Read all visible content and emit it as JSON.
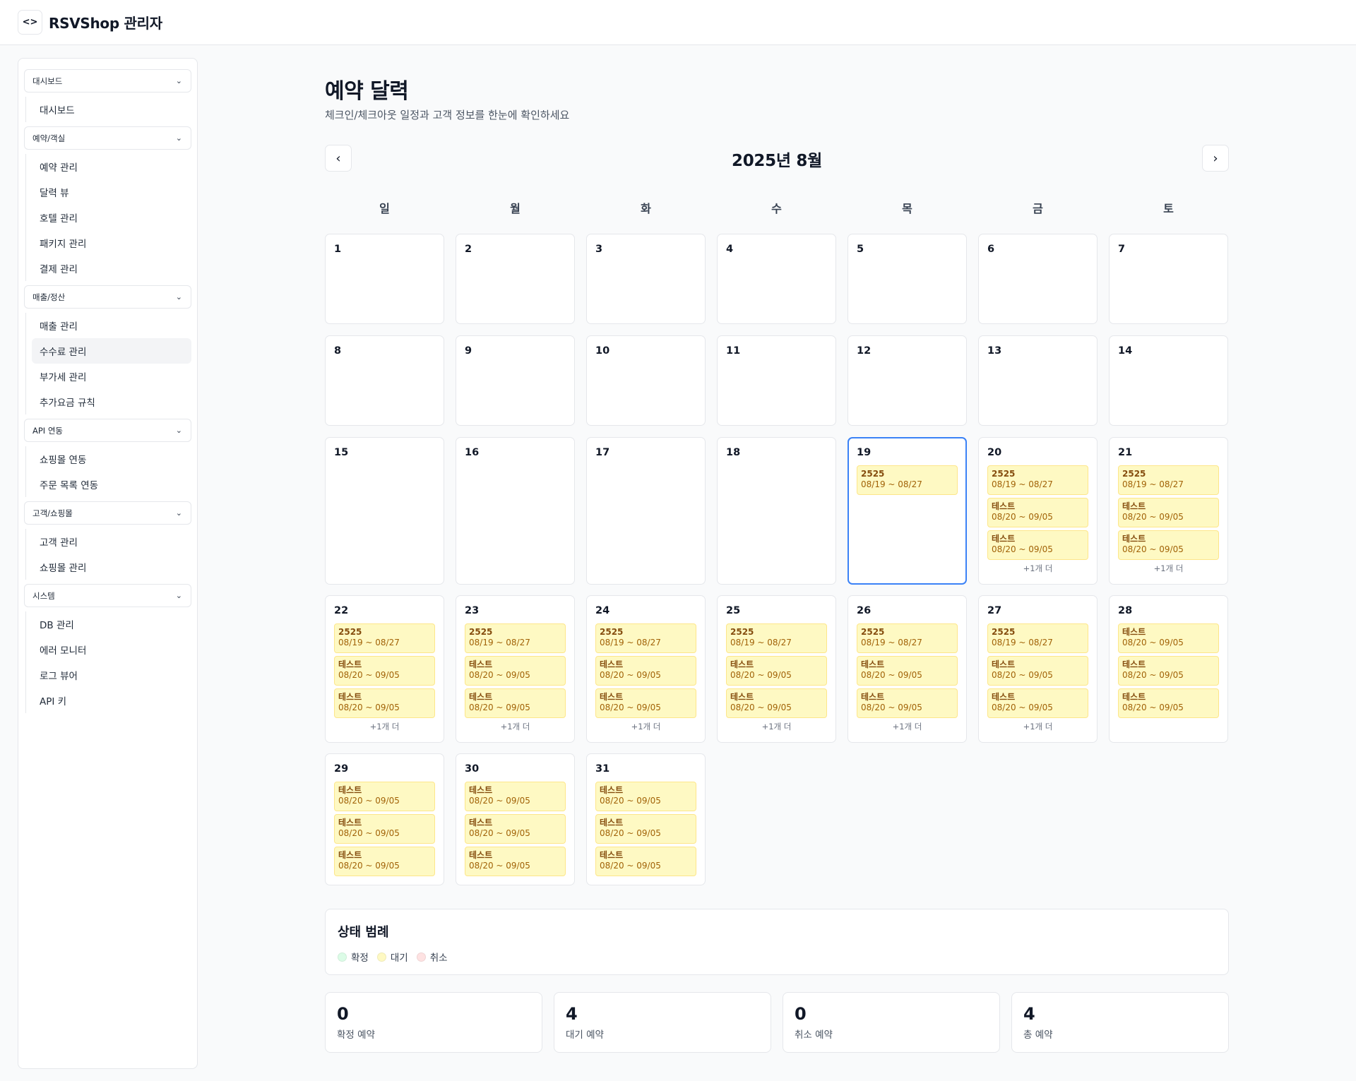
{
  "header": {
    "toggle_icon": "<>",
    "title": "RSVShop 관리자"
  },
  "sidebar": {
    "groups": [
      {
        "label": "대시보드",
        "items": [
          "대시보드"
        ]
      },
      {
        "label": "예약/객실",
        "items": [
          "예약 관리",
          "달력 뷰",
          "호텔 관리",
          "패키지 관리",
          "결제 관리"
        ]
      },
      {
        "label": "매출/정산",
        "items": [
          "매출 관리",
          "수수료 관리",
          "부가세 관리",
          "추가요금 규칙"
        ]
      },
      {
        "label": "API 연동",
        "items": [
          "쇼핑몰 연동",
          "주문 목록 연동"
        ]
      },
      {
        "label": "고객/쇼핑몰",
        "items": [
          "고객 관리",
          "쇼핑몰 관리"
        ]
      },
      {
        "label": "시스템",
        "items": [
          "DB 관리",
          "에러 모니터",
          "로그 뷰어",
          "API 키"
        ]
      }
    ],
    "active_item": "수수료 관리"
  },
  "page": {
    "title": "예약 달력",
    "subtitle": "체크인/체크아웃 일정과 고객 정보를 한눈에 확인하세요"
  },
  "calendar": {
    "month_label": "2025년 8월",
    "weekdays": [
      "일",
      "월",
      "화",
      "수",
      "목",
      "금",
      "토"
    ],
    "today": 19,
    "weeks": [
      [
        {
          "day": "1",
          "events": [],
          "more": ""
        },
        {
          "day": "2",
          "events": [],
          "more": ""
        },
        {
          "day": "3",
          "events": [],
          "more": ""
        },
        {
          "day": "4",
          "events": [],
          "more": ""
        },
        {
          "day": "5",
          "events": [],
          "more": ""
        },
        {
          "day": "6",
          "events": [],
          "more": ""
        },
        {
          "day": "7",
          "events": [],
          "more": ""
        }
      ],
      [
        {
          "day": "8",
          "events": [],
          "more": ""
        },
        {
          "day": "9",
          "events": [],
          "more": ""
        },
        {
          "day": "10",
          "events": [],
          "more": ""
        },
        {
          "day": "11",
          "events": [],
          "more": ""
        },
        {
          "day": "12",
          "events": [],
          "more": ""
        },
        {
          "day": "13",
          "events": [],
          "more": ""
        },
        {
          "day": "14",
          "events": [],
          "more": ""
        }
      ],
      [
        {
          "day": "15",
          "events": [],
          "more": ""
        },
        {
          "day": "16",
          "events": [],
          "more": ""
        },
        {
          "day": "17",
          "events": [],
          "more": ""
        },
        {
          "day": "18",
          "events": [],
          "more": ""
        },
        {
          "day": "19",
          "events": [
            {
              "title": "2525",
              "dates": "08/19 ~ 08/27"
            }
          ],
          "more": ""
        },
        {
          "day": "20",
          "events": [
            {
              "title": "2525",
              "dates": "08/19 ~ 08/27"
            },
            {
              "title": "테스트",
              "dates": "08/20 ~ 09/05"
            },
            {
              "title": "테스트",
              "dates": "08/20 ~ 09/05"
            }
          ],
          "more": "+1개 더"
        },
        {
          "day": "21",
          "events": [
            {
              "title": "2525",
              "dates": "08/19 ~ 08/27"
            },
            {
              "title": "테스트",
              "dates": "08/20 ~ 09/05"
            },
            {
              "title": "테스트",
              "dates": "08/20 ~ 09/05"
            }
          ],
          "more": "+1개 더"
        }
      ],
      [
        {
          "day": "22",
          "events": [
            {
              "title": "2525",
              "dates": "08/19 ~ 08/27"
            },
            {
              "title": "테스트",
              "dates": "08/20 ~ 09/05"
            },
            {
              "title": "테스트",
              "dates": "08/20 ~ 09/05"
            }
          ],
          "more": "+1개 더"
        },
        {
          "day": "23",
          "events": [
            {
              "title": "2525",
              "dates": "08/19 ~ 08/27"
            },
            {
              "title": "테스트",
              "dates": "08/20 ~ 09/05"
            },
            {
              "title": "테스트",
              "dates": "08/20 ~ 09/05"
            }
          ],
          "more": "+1개 더"
        },
        {
          "day": "24",
          "events": [
            {
              "title": "2525",
              "dates": "08/19 ~ 08/27"
            },
            {
              "title": "테스트",
              "dates": "08/20 ~ 09/05"
            },
            {
              "title": "테스트",
              "dates": "08/20 ~ 09/05"
            }
          ],
          "more": "+1개 더"
        },
        {
          "day": "25",
          "events": [
            {
              "title": "2525",
              "dates": "08/19 ~ 08/27"
            },
            {
              "title": "테스트",
              "dates": "08/20 ~ 09/05"
            },
            {
              "title": "테스트",
              "dates": "08/20 ~ 09/05"
            }
          ],
          "more": "+1개 더"
        },
        {
          "day": "26",
          "events": [
            {
              "title": "2525",
              "dates": "08/19 ~ 08/27"
            },
            {
              "title": "테스트",
              "dates": "08/20 ~ 09/05"
            },
            {
              "title": "테스트",
              "dates": "08/20 ~ 09/05"
            }
          ],
          "more": "+1개 더"
        },
        {
          "day": "27",
          "events": [
            {
              "title": "2525",
              "dates": "08/19 ~ 08/27"
            },
            {
              "title": "테스트",
              "dates": "08/20 ~ 09/05"
            },
            {
              "title": "테스트",
              "dates": "08/20 ~ 09/05"
            }
          ],
          "more": "+1개 더"
        },
        {
          "day": "28",
          "events": [
            {
              "title": "테스트",
              "dates": "08/20 ~ 09/05"
            },
            {
              "title": "테스트",
              "dates": "08/20 ~ 09/05"
            },
            {
              "title": "테스트",
              "dates": "08/20 ~ 09/05"
            }
          ],
          "more": ""
        }
      ],
      [
        {
          "day": "29",
          "events": [
            {
              "title": "테스트",
              "dates": "08/20 ~ 09/05"
            },
            {
              "title": "테스트",
              "dates": "08/20 ~ 09/05"
            },
            {
              "title": "테스트",
              "dates": "08/20 ~ 09/05"
            }
          ],
          "more": ""
        },
        {
          "day": "30",
          "events": [
            {
              "title": "테스트",
              "dates": "08/20 ~ 09/05"
            },
            {
              "title": "테스트",
              "dates": "08/20 ~ 09/05"
            },
            {
              "title": "테스트",
              "dates": "08/20 ~ 09/05"
            }
          ],
          "more": ""
        },
        {
          "day": "31",
          "events": [
            {
              "title": "테스트",
              "dates": "08/20 ~ 09/05"
            },
            {
              "title": "테스트",
              "dates": "08/20 ~ 09/05"
            },
            {
              "title": "테스트",
              "dates": "08/20 ~ 09/05"
            }
          ],
          "more": ""
        }
      ]
    ]
  },
  "legend": {
    "title": "상태 범례",
    "items": [
      {
        "label": "확정",
        "color": "#dcfce7"
      },
      {
        "label": "대기",
        "color": "#fef9c3"
      },
      {
        "label": "취소",
        "color": "#fee2e2"
      }
    ]
  },
  "stats": [
    {
      "value": "0",
      "label": "확정 예약"
    },
    {
      "value": "4",
      "label": "대기 예약"
    },
    {
      "value": "0",
      "label": "취소 예약"
    },
    {
      "value": "4",
      "label": "총 예약"
    }
  ]
}
